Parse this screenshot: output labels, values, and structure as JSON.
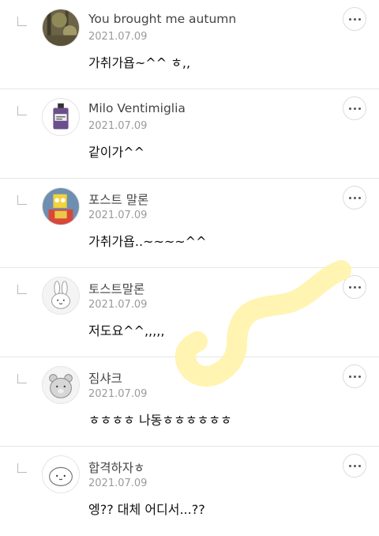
{
  "comments": [
    {
      "author": "You brought me autumn",
      "date": "2021.07.09",
      "text": "가취가욥~^^ ㅎ,,",
      "avatar_icon": "autumn-photo-avatar"
    },
    {
      "author": "Milo Ventimiglia",
      "date": "2021.07.09",
      "text": "같이가^^",
      "avatar_icon": "perfume-bottle-avatar"
    },
    {
      "author": "포스트 말론",
      "date": "2021.07.09",
      "text": "가취가욥..~~~~^^",
      "avatar_icon": "cartoon-character-avatar"
    },
    {
      "author": "토스트말론",
      "date": "2021.07.09",
      "text": "저도요^^,,,,,",
      "avatar_icon": "rabbit-avatar"
    },
    {
      "author": "짐샤크",
      "date": "2021.07.09",
      "text": "ㅎㅎㅎㅎ 나동ㅎㅎㅎㅎㅎㅎ",
      "avatar_icon": "bear-avatar"
    },
    {
      "author": "합격하자ㅎ",
      "date": "2021.07.09",
      "text": "엥?? 대체 어디서...??",
      "avatar_icon": "blob-avatar"
    }
  ],
  "colors": {
    "highlight": "#fff3a8",
    "separator": "#e6e6e6",
    "date": "#9a9a9a"
  }
}
